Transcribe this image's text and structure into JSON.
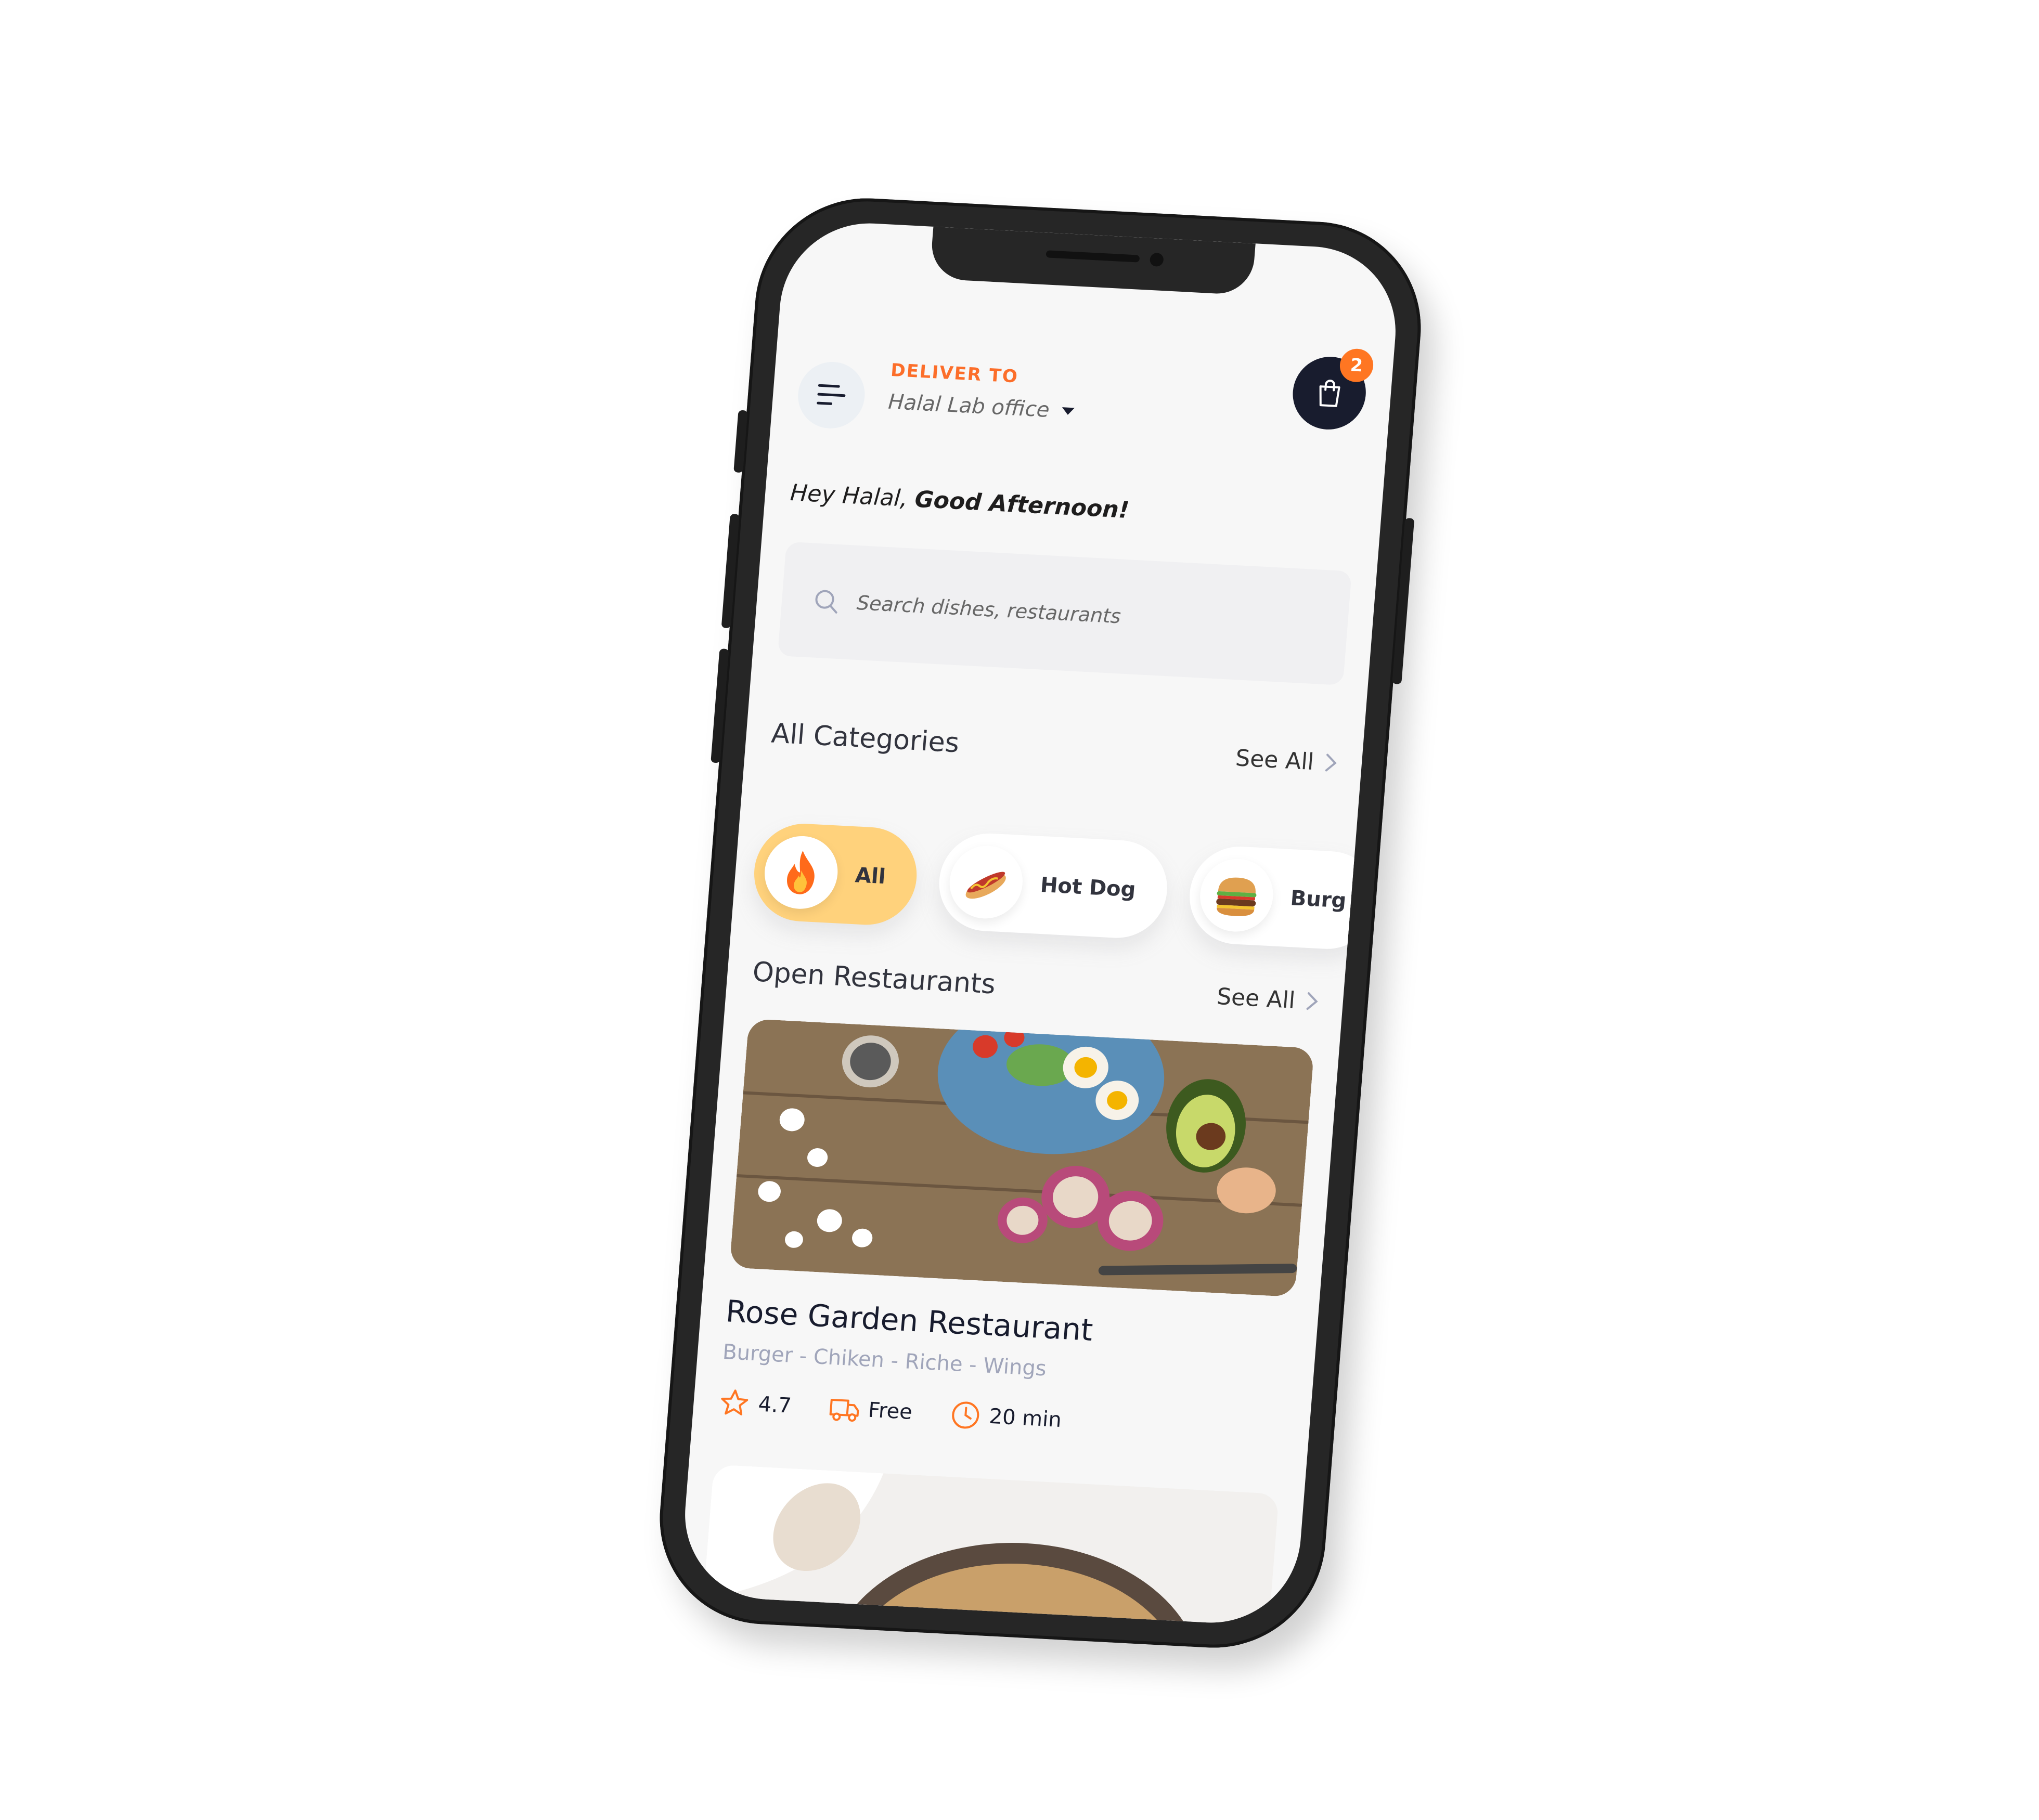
{
  "header": {
    "deliver_label": "DELIVER TO",
    "location": "Halal Lab office",
    "cart_count": "2"
  },
  "greeting": {
    "prefix": "Hey Halal,",
    "emphasis": "Good Afternoon!"
  },
  "search": {
    "placeholder": "Search dishes, restaurants"
  },
  "categories_section": {
    "title": "All Categories",
    "see_all": "See All",
    "items": [
      {
        "label": "All",
        "icon": "fire-icon",
        "active": true
      },
      {
        "label": "Hot Dog",
        "icon": "hot-dog-icon",
        "active": false
      },
      {
        "label": "Burg",
        "icon": "burger-icon",
        "active": false
      }
    ]
  },
  "restaurants_section": {
    "title": "Open Restaurants",
    "see_all": "See All",
    "items": [
      {
        "name": "Rose Garden Restaurant",
        "tags": "Burger - Chiken - Riche - Wings",
        "rating": "4.7",
        "delivery": "Free",
        "time": "20 min"
      }
    ]
  },
  "colors": {
    "accent": "#ff7622",
    "active_category": "#ffd27c",
    "dark": "#181c2e",
    "phone_frame": "#262626"
  }
}
